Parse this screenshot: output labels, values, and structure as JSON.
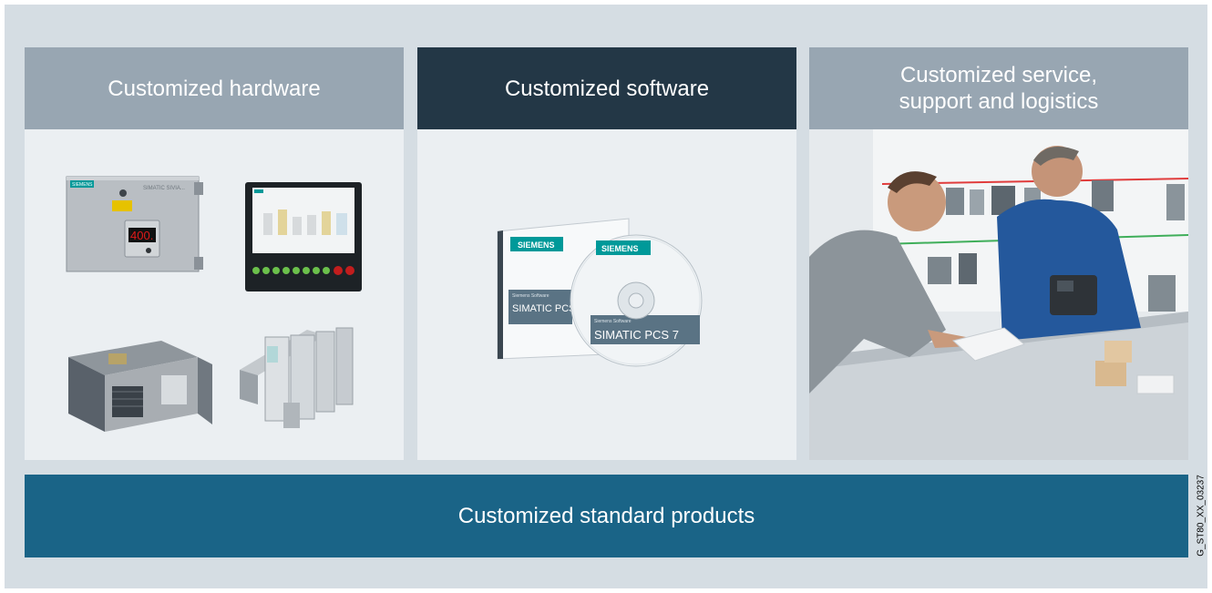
{
  "columns": [
    {
      "title": "Customized hardware"
    },
    {
      "title": "Customized software"
    },
    {
      "title": "Customized service, support and logistics"
    }
  ],
  "bottom_bar": {
    "label": "Customized standard products"
  },
  "figure_id": "G_ST80_XX_03237",
  "hardware": {
    "enclosure_brand": "SIEMENS",
    "enclosure_model": "SIMATIC SIVIA...",
    "display_value": "400.",
    "panel_brand": "SIEMENS"
  },
  "software": {
    "brand": "SIEMENS",
    "case_title": "SIMATIC PCS",
    "disc_title": "SIMATIC PCS 7",
    "series_label": "Siemens Software"
  },
  "colors": {
    "background": "#d5dde3",
    "header_light": "#98a6b2",
    "header_dark": "#233746",
    "bottom_bar": "#1a6487",
    "panel": "#ebeff2",
    "siemens_teal": "#009999",
    "display_red": "#e01a1a"
  }
}
